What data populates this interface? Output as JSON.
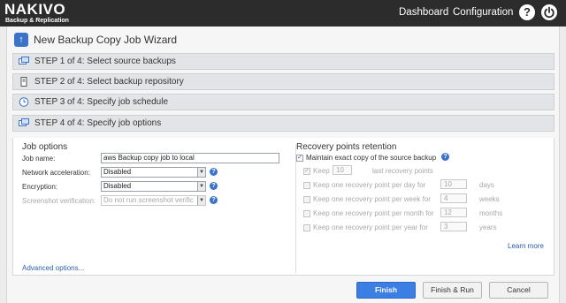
{
  "app": {
    "brand": "NAKIVO",
    "brand_sub": "Backup & Replication",
    "nav": {
      "dashboard": "Dashboard",
      "configuration": "Configuration"
    },
    "icons": {
      "help": "help-icon",
      "power": "power-icon"
    }
  },
  "wizard": {
    "title": "New Backup Copy Job Wizard",
    "steps": [
      {
        "label": "STEP 1 of 4: Select source backups",
        "icon": "backup-copy-icon"
      },
      {
        "label": "STEP 2 of 4: Select backup repository",
        "icon": "repository-icon"
      },
      {
        "label": "STEP 3 of 4: Specify job schedule",
        "icon": "clock-icon"
      },
      {
        "label": "STEP 4 of 4: Specify job options",
        "icon": "options-icon"
      }
    ]
  },
  "job_options": {
    "title": "Job options",
    "job_name_label": "Job name:",
    "job_name_value": "aws Backup copy job to local",
    "network_label": "Network acceleration:",
    "network_value": "Disabled",
    "encryption_label": "Encryption:",
    "encryption_value": "Disabled",
    "screenshot_label": "Screenshot verification:",
    "screenshot_value": "Do not run screenshot verific",
    "advanced_link": "Advanced options..."
  },
  "recovery": {
    "title": "Recovery points retention",
    "maintain_label": "Maintain exact copy of the source backup",
    "maintain_checked": true,
    "keep_label": "Keep",
    "keep_value": "10",
    "keep_suffix": "last recovery points",
    "rows": [
      {
        "label": "Keep one recovery point per day for",
        "value": "10",
        "unit": "days"
      },
      {
        "label": "Keep one recovery point per week for",
        "value": "4",
        "unit": "weeks"
      },
      {
        "label": "Keep one recovery point per month for",
        "value": "12",
        "unit": "months"
      },
      {
        "label": "Keep one recovery point per year for",
        "value": "3",
        "unit": "years"
      }
    ],
    "learn_more": "Learn more"
  },
  "buttons": {
    "finish": "Finish",
    "finish_run": "Finish & Run",
    "cancel": "Cancel"
  },
  "colors": {
    "accent": "#3b7ee4",
    "topbar": "#2c2c2c",
    "link": "#2a5db0"
  }
}
